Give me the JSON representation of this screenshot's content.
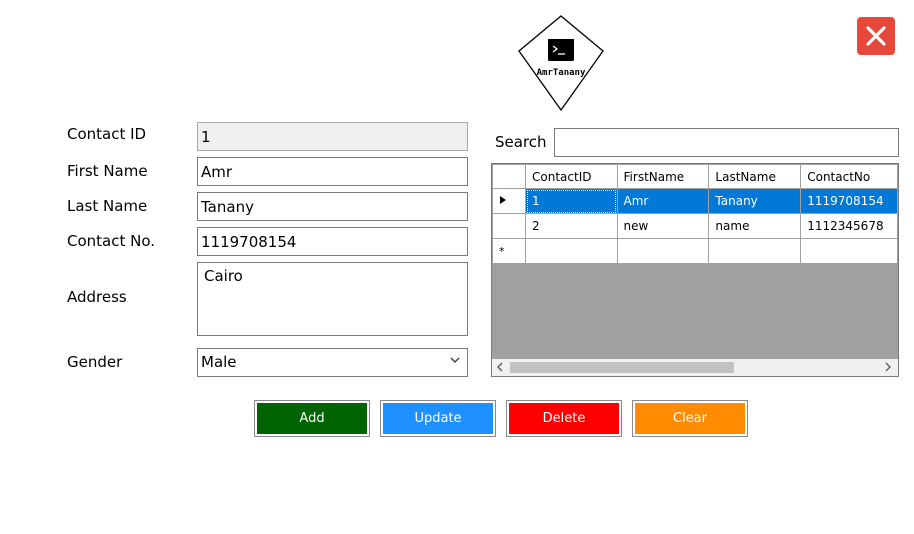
{
  "logo": {
    "text": "AmrTanany",
    "icon": "terminal-icon"
  },
  "close": {
    "icon": "close-icon",
    "color": "#e8473c"
  },
  "form": {
    "contact_id_label": "Contact ID",
    "contact_id_value": "1",
    "first_name_label": "First Name",
    "first_name_value": "Amr",
    "last_name_label": "Last Name",
    "last_name_value": "Tanany",
    "contact_no_label": "Contact No.",
    "contact_no_value": "1119708154",
    "address_label": "Address",
    "address_value": "Cairo",
    "gender_label": "Gender",
    "gender_value": "Male"
  },
  "search": {
    "label": "Search",
    "value": ""
  },
  "grid": {
    "columns": [
      "ContactID",
      "FirstName",
      "LastName",
      "ContactNo"
    ],
    "rows": [
      {
        "id": "1",
        "first": "Amr",
        "last": "Tanany",
        "no": "1119708154",
        "selected": true
      },
      {
        "id": "2",
        "first": "new",
        "last": "name",
        "no": "1112345678",
        "selected": false
      }
    ],
    "new_row_marker": "*"
  },
  "buttons": {
    "add": {
      "label": "Add",
      "color": "#006400"
    },
    "update": {
      "label": "Update",
      "color": "#1e90ff"
    },
    "delete": {
      "label": "Delete",
      "color": "#ff0000"
    },
    "clear": {
      "label": "Clear",
      "color": "#ff8c00"
    }
  }
}
